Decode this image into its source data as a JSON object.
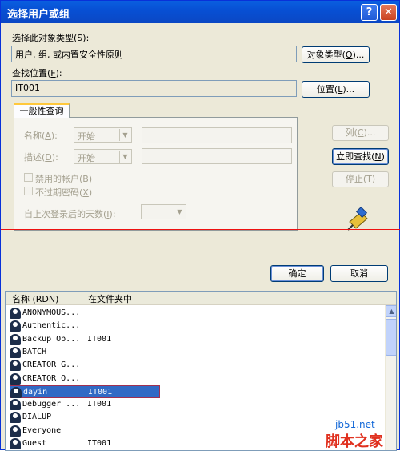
{
  "window": {
    "title": "选择用户或组",
    "help_icon": "?",
    "close_icon": "✕"
  },
  "object_type": {
    "label": "选择此对象类型(",
    "key": "S",
    "label_end": "):",
    "value": "用户, 组, 或内置安全性原则",
    "button": "对象类型(",
    "button_key": "O",
    "button_end": ")..."
  },
  "location": {
    "label": "查找位置(",
    "key": "F",
    "label_end": "):",
    "value": "IT001",
    "button": "位置(",
    "button_key": "L",
    "button_end": ")..."
  },
  "query": {
    "tab": "一般性查询",
    "name_label": "名称(",
    "name_key": "A",
    "name_end": "):",
    "name_op": "开始",
    "desc_label": "描述(",
    "desc_key": "D",
    "desc_end": "):",
    "desc_op": "开始",
    "disabled_label": "禁用的帐户(",
    "disabled_key": "B",
    "disabled_end": ")",
    "noexpire_label": "不过期密码(",
    "noexpire_key": "X",
    "noexpire_end": ")",
    "days_label": "自上次登录后的天数(",
    "days_key": "I",
    "days_end": "):"
  },
  "buttons": {
    "columns": "列(",
    "columns_key": "C",
    "columns_end": ")...",
    "find_now": "立即查找(",
    "find_now_key": "N",
    "find_now_end": ")",
    "stop": "停止(",
    "stop_key": "T",
    "stop_end": ")",
    "ok": "确定",
    "cancel": "取消"
  },
  "results": {
    "columns": [
      "名称 (RDN)",
      "在文件夹中"
    ],
    "rows": [
      {
        "name": "ANONYMOUS...",
        "folder": ""
      },
      {
        "name": "Authentic...",
        "folder": ""
      },
      {
        "name": "Backup Op...",
        "folder": "IT001"
      },
      {
        "name": "BATCH",
        "folder": ""
      },
      {
        "name": "CREATOR G...",
        "folder": ""
      },
      {
        "name": "CREATOR O...",
        "folder": ""
      },
      {
        "name": "dayin",
        "folder": "IT001"
      },
      {
        "name": "Debugger ...",
        "folder": "IT001"
      },
      {
        "name": "DIALUP",
        "folder": ""
      },
      {
        "name": "Everyone",
        "folder": ""
      },
      {
        "name": "Guest",
        "folder": "IT001"
      }
    ],
    "selected_index": 6
  },
  "watermark": {
    "site": "jb51.net",
    "brand": "脚本之家"
  }
}
